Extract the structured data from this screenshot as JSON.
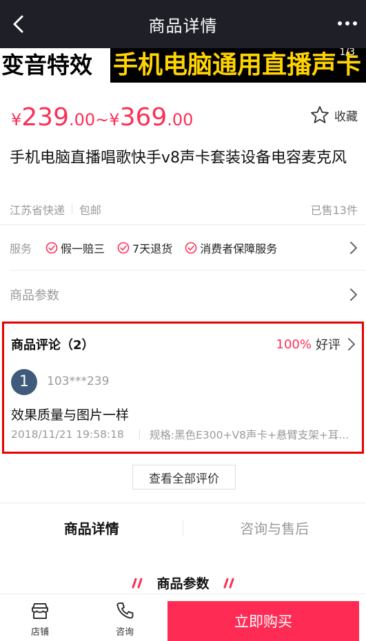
{
  "nav": {
    "title": "商品详情"
  },
  "banner": {
    "left_text": "变音特效",
    "right_text": "手机电脑通用直播声卡",
    "counter": "1/3"
  },
  "price": {
    "low_symbol": "¥",
    "low_int": "239",
    "low_dec": ".00",
    "tilde": "~",
    "high_symbol": "¥",
    "high_int": "369",
    "high_dec": ".00"
  },
  "favorite": {
    "label": "收藏"
  },
  "product": {
    "title": "手机电脑直播唱歌快手v8声卡套装设备电容麦克风"
  },
  "shipping": {
    "origin": "江苏省快递",
    "fee": "包邮",
    "sold": "已售13件"
  },
  "service": {
    "label": "服务",
    "tags": [
      "假一赔三",
      "7天退货",
      "消费者保障服务"
    ]
  },
  "params": {
    "label": "商品参数"
  },
  "reviews": {
    "title": "商品评论（2）",
    "rate": "100%",
    "rate_label": "好评",
    "items": [
      {
        "avatar_text": "1",
        "user": "103***239",
        "comment": "效果质量与图片一样",
        "time": "2018/11/21 19:58:18",
        "spec": "规格:黑色E300+V8声卡+悬臂支架+耳..."
      }
    ],
    "view_all": "查看全部评价"
  },
  "tabs": [
    {
      "label": "商品详情",
      "active": true
    },
    {
      "label": "咨询与售后",
      "active": false
    }
  ],
  "section": {
    "title": "商品参数"
  },
  "bottom": {
    "shop_label": "店铺",
    "consult_label": "咨询",
    "buy_label": "立即购买"
  },
  "colors": {
    "accent": "#fe2c55",
    "price": "#ff2d55",
    "nav_bg": "#1f2027",
    "highlight_border": "#e60000"
  }
}
